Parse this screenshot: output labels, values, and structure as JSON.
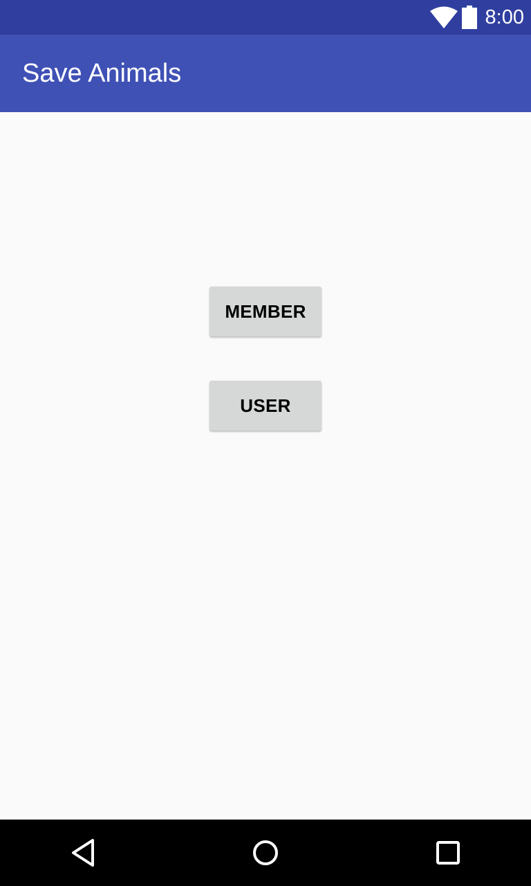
{
  "status_bar": {
    "time": "8:00",
    "icons": [
      "wifi-icon",
      "battery-icon"
    ],
    "color": "#303f9f"
  },
  "app_bar": {
    "title": "Save Animals",
    "color": "#3f51b5"
  },
  "buttons": {
    "member": "MEMBER",
    "user": "USER"
  },
  "nav_bar": {
    "icons": [
      "back-icon",
      "home-icon",
      "recent-apps-icon"
    ]
  }
}
